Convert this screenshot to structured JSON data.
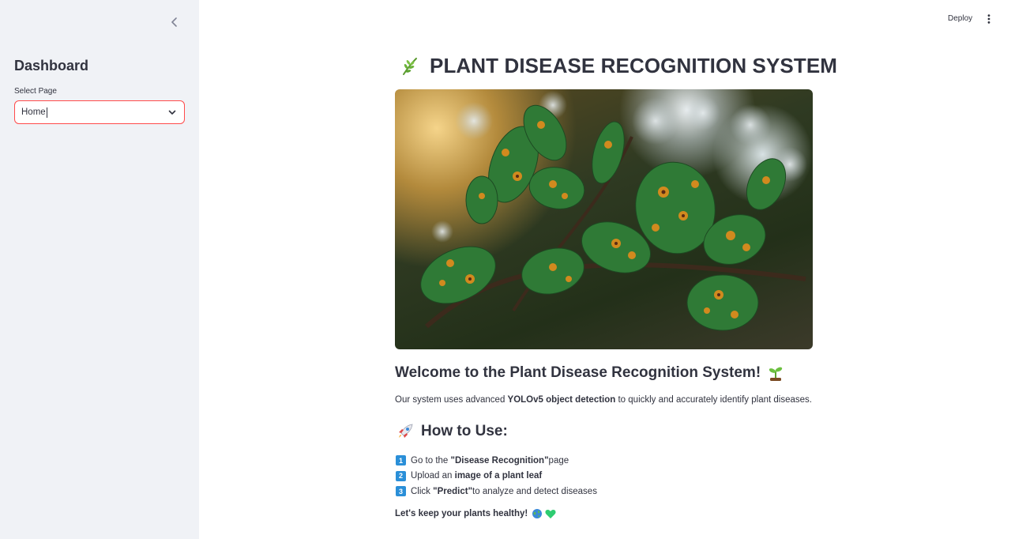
{
  "sidebar": {
    "title": "Dashboard",
    "select_label": "Select Page",
    "select_value": "Home"
  },
  "header": {
    "deploy_label": "Deploy"
  },
  "main": {
    "title": "PLANT DISEASE RECOGNITION SYSTEM",
    "welcome_heading": "Welcome to the Plant Disease Recognition System!",
    "intro": {
      "prefix": "Our system uses advanced ",
      "bold": "YOLOv5 object detection",
      "suffix": " to quickly and accurately identify plant diseases."
    },
    "howto_heading": "How to Use:",
    "steps": [
      {
        "num": "1",
        "pre": "Go to the ",
        "bold": "\"Disease Recognition\"",
        "post": " page"
      },
      {
        "num": "2",
        "pre": "Upload an ",
        "bold": "image of a plant leaf",
        "post": ""
      },
      {
        "num": "3",
        "pre": "Click ",
        "bold": "\"Predict\"",
        "post": " to analyze and detect diseases"
      }
    ],
    "closing": "Let's keep your plants healthy!"
  },
  "colors": {
    "sidebar_bg": "#f0f2f6",
    "accent": "#ff4b4b",
    "text": "#31333f",
    "badge": "#2a8fd8"
  }
}
